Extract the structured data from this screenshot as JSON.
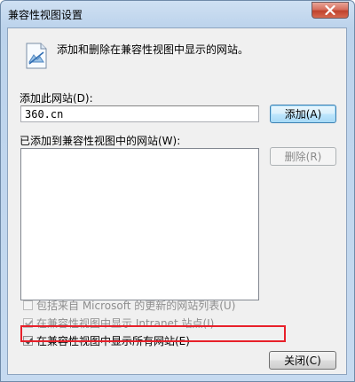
{
  "window": {
    "title": "兼容性视图设置",
    "close_icon": "close-icon"
  },
  "header": {
    "icon": "compat-view-icon",
    "description": "添加和删除在兼容性视图中显示的网站。"
  },
  "add_site": {
    "label": "添加此网站(D):",
    "value": "360.cn",
    "button": "添加(A)"
  },
  "site_list": {
    "label": "已添加到兼容性视图中的网站(W):",
    "items": [],
    "remove_button": "删除(R)"
  },
  "options": {
    "microsoft_list": {
      "label": "包括来自 Microsoft 的更新的网站列表(U)",
      "checked": false,
      "enabled": false
    },
    "intranet": {
      "label": "在兼容性视图中显示 Intranet 站点(I)",
      "checked": true,
      "enabled": false
    },
    "all_sites": {
      "label": "在兼容性视图中显示所有网站(E)",
      "checked": true,
      "enabled": true
    }
  },
  "footer": {
    "close_button": "关闭(C)"
  },
  "colors": {
    "highlight_border": "#e8202a",
    "title_close_red": "#c0432d",
    "client_background": "#f0f0f0"
  }
}
